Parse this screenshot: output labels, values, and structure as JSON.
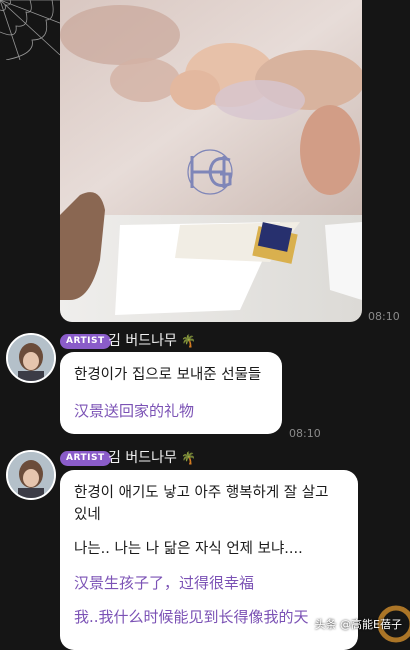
{
  "photo_message": {
    "timestamp": "08:10",
    "monogram_letters": "HG"
  },
  "messages": [
    {
      "badge": "ARTIST",
      "sender": "김 버드나무",
      "sender_emoji": "🌴",
      "lines_korean": [
        "한경이가 집으로 보내준 선물들"
      ],
      "lines_chinese": [
        "汉景送回家的礼物"
      ],
      "timestamp": "08:10"
    },
    {
      "badge": "ARTIST",
      "sender": "김 버드나무",
      "sender_emoji": "🌴",
      "lines_korean": [
        "한경이 애기도 낳고 아주 행복하게 잘 살고",
        "있네",
        "나는.. 나는 나 닮은 자식 언제 보냐...."
      ],
      "lines_chinese": [
        "汉景生孩子了，过得很幸福",
        "我..我什么时候能见到长得像我的天"
      ]
    }
  ],
  "watermark": "头条 @高能E蓓子",
  "colors": {
    "background": "#151515",
    "bubble": "#ffffff",
    "badge": "#8a5cc9",
    "chinese_text": "#7b52b5"
  }
}
